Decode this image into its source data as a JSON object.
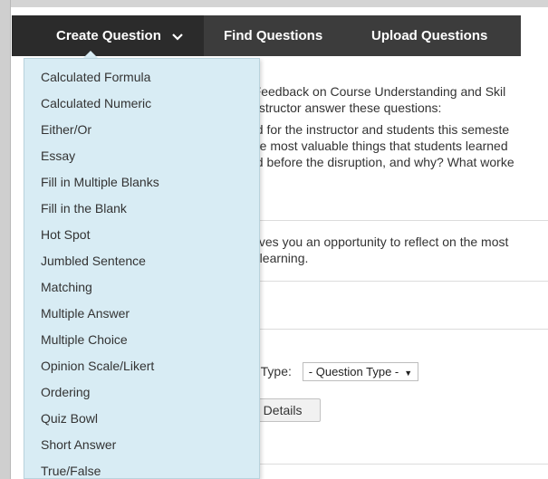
{
  "toolbar": {
    "create_label": "Create Question",
    "find_label": "Find Questions",
    "upload_label": "Upload Questions"
  },
  "create_menu": {
    "items": [
      "Calculated Formula",
      "Calculated Numeric",
      "Either/Or",
      "Essay",
      "Fill in Multiple Blanks",
      "Fill in the Blank",
      "Hot Spot",
      "Jumbled Sentence",
      "Matching",
      "Multiple Answer",
      "Multiple Choice",
      "Opinion Scale/Likert",
      "Ordering",
      "Quiz Bowl",
      "Short Answer",
      "True/False"
    ]
  },
  "content": {
    "intro_line1": "(Feedback on Course Understanding and Skil",
    "intro_line2": "instructor answer these questions:",
    "para_line1": "ed for the instructor and students this semeste",
    "para_line2": "the most valuable things that students learned",
    "para_line3": "ed before the disruption, and why? What worke",
    "reflect_line1": "gives you an opportunity to reflect on the most",
    "reflect_line2": "e learning.",
    "qtype_label": "y Type:",
    "qtype_select_value": "- Question Type -",
    "details_button": "n Details"
  },
  "icons": {
    "create_chevron": "chevron-down-icon",
    "select_arrow": "triangle-down-icon"
  }
}
